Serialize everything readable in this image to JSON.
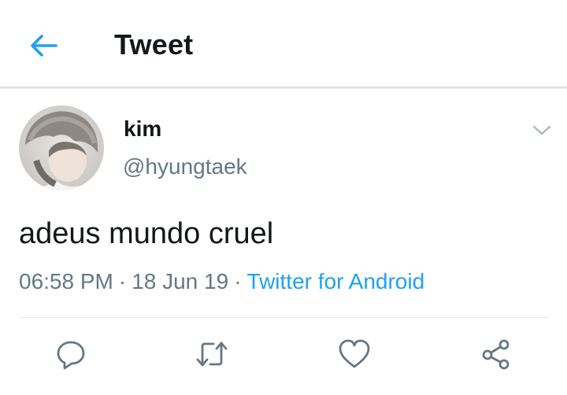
{
  "header": {
    "back_icon": "back-arrow-icon",
    "title": "Tweet"
  },
  "tweet": {
    "author": {
      "display_name": "kim",
      "handle": "@hyungtaek"
    },
    "text": "adeus mundo cruel",
    "time": "06:58 PM",
    "date": "18 Jun 19",
    "separator": "·",
    "source": "Twitter for Android",
    "menu_icon": "chevron-down-icon"
  },
  "actions": [
    {
      "name": "reply",
      "icon": "reply-icon"
    },
    {
      "name": "retweet",
      "icon": "retweet-icon"
    },
    {
      "name": "like",
      "icon": "heart-icon"
    },
    {
      "name": "share",
      "icon": "share-icon"
    }
  ],
  "colors": {
    "accent": "#1da1f2",
    "text": "#14171a",
    "secondary": "#657786",
    "icon": "#657786",
    "divider": "#e1e8ed"
  }
}
